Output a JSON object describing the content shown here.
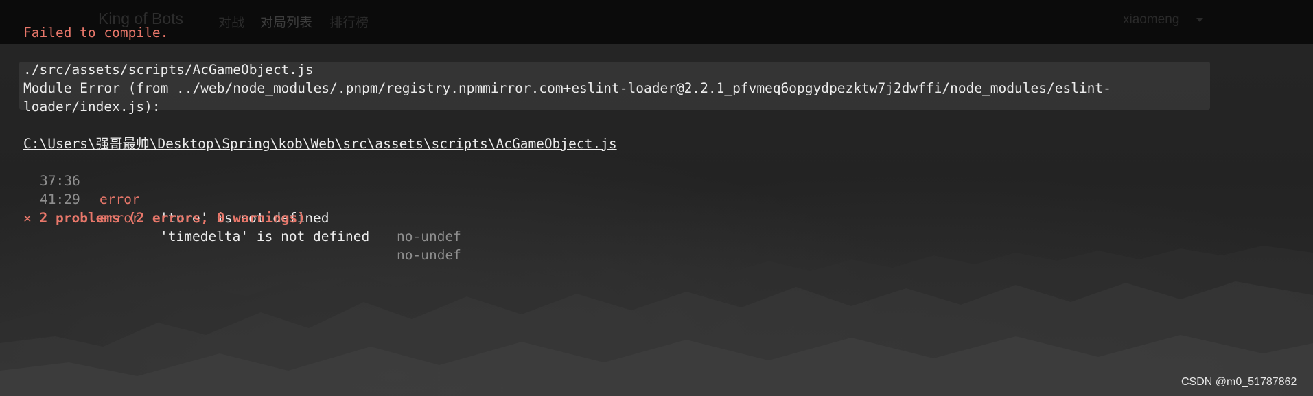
{
  "navbar": {
    "brand": "King of Bots",
    "links": [
      "对战",
      "对局列表",
      "排行榜"
    ],
    "username": "xiaomeng"
  },
  "overlay": {
    "title": "Failed to compile.",
    "module_path": "./src/assets/scripts/AcGameObject.js",
    "module_error_line1": "Module Error (from ../web/node_modules/.pnpm/registry.npmmirror.com+eslint-loader@2.2.1_pfvmeq6opgydpezktw7j2dwffi/node_modules/eslint-",
    "module_error_line2": "loader/index.js):",
    "file_path": "C:\\Users\\强哥最帅\\Desktop\\Spring\\kob\\Web\\src\\assets\\scripts\\AcGameObject.js",
    "errors": [
      {
        "position": "37:36",
        "level": "error",
        "message": "'ture' is not defined",
        "rule": "no-undef"
      },
      {
        "position": "41:29",
        "level": "error",
        "message": "'timedelta' is not defined",
        "rule": "no-undef"
      }
    ],
    "summary_icon": "✕",
    "summary_icon_name": "x-icon",
    "summary": "2 problems (2 errors, 0 warnings)"
  },
  "watermark": "CSDN @m0_51787862",
  "colors": {
    "error_red": "#e8776a",
    "text_white": "#ececec",
    "text_gray": "#8f8f8f",
    "navbar_bg": "#0b0b0b"
  }
}
